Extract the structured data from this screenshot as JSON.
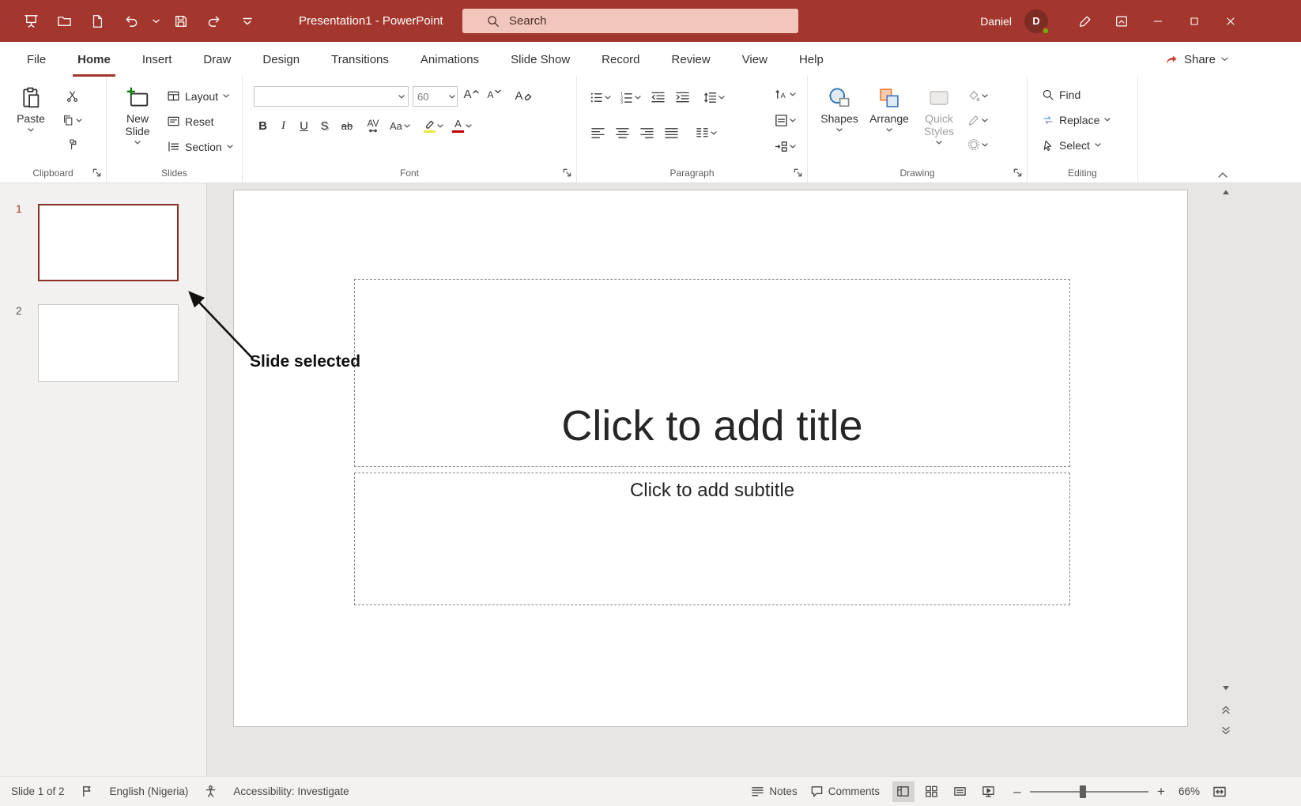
{
  "titlebar": {
    "title": "Presentation1 - PowerPoint",
    "search_placeholder": "Search",
    "user_name": "Daniel",
    "user_initial": "D"
  },
  "tabs": {
    "items": [
      {
        "label": "File"
      },
      {
        "label": "Home"
      },
      {
        "label": "Insert"
      },
      {
        "label": "Draw"
      },
      {
        "label": "Design"
      },
      {
        "label": "Transitions"
      },
      {
        "label": "Animations"
      },
      {
        "label": "Slide Show"
      },
      {
        "label": "Record"
      },
      {
        "label": "Review"
      },
      {
        "label": "View"
      },
      {
        "label": "Help"
      }
    ],
    "share_label": "Share"
  },
  "ribbon": {
    "clipboard": {
      "label": "Clipboard",
      "paste_label": "Paste"
    },
    "slides": {
      "label": "Slides",
      "new_slide_label": "New Slide",
      "layout_label": "Layout",
      "reset_label": "Reset",
      "section_label": "Section"
    },
    "font": {
      "label": "Font",
      "font_name_value": "",
      "font_size_value": "60",
      "bold_label": "B",
      "italic_label": "I",
      "underline_label": "U",
      "shadow_label": "S",
      "strikethrough_label": "ab",
      "spacing_label": "AV",
      "case_label": "Aa"
    },
    "paragraph": {
      "label": "Paragraph"
    },
    "drawing": {
      "label": "Drawing",
      "shapes_label": "Shapes",
      "arrange_label": "Arrange",
      "quick_styles_label": "Quick Styles"
    },
    "editing": {
      "label": "Editing",
      "find_label": "Find",
      "replace_label": "Replace",
      "select_label": "Select"
    }
  },
  "slides_panel": {
    "slide1_number": "1",
    "slide2_number": "2"
  },
  "annotation": {
    "label": "Slide selected"
  },
  "slide": {
    "title_placeholder": "Click to add title",
    "subtitle_placeholder": "Click to add subtitle"
  },
  "statusbar": {
    "slide_info": "Slide 1 of 2",
    "language": "English (Nigeria)",
    "accessibility": "Accessibility: Investigate",
    "notes_label": "Notes",
    "comments_label": "Comments",
    "zoom_value": "66%"
  }
}
